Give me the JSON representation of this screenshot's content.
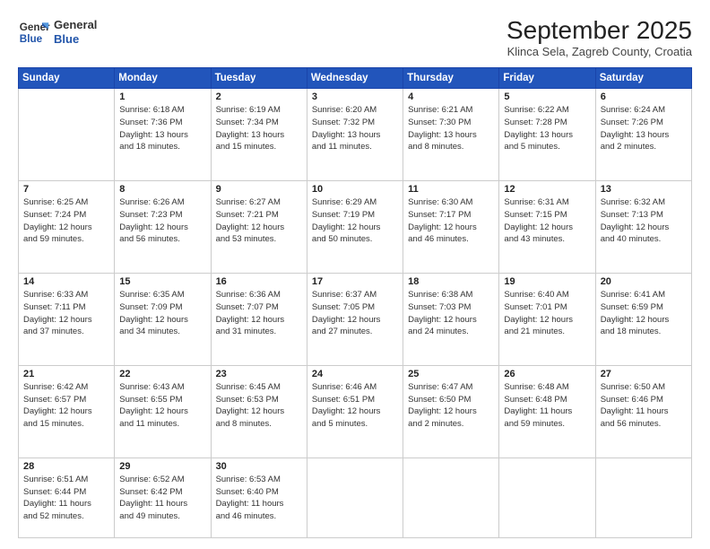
{
  "header": {
    "logo_line1": "General",
    "logo_line2": "Blue",
    "month": "September 2025",
    "location": "Klinca Sela, Zagreb County, Croatia"
  },
  "weekdays": [
    "Sunday",
    "Monday",
    "Tuesday",
    "Wednesday",
    "Thursday",
    "Friday",
    "Saturday"
  ],
  "rows": [
    [
      {
        "day": "",
        "info": ""
      },
      {
        "day": "1",
        "info": "Sunrise: 6:18 AM\nSunset: 7:36 PM\nDaylight: 13 hours\nand 18 minutes."
      },
      {
        "day": "2",
        "info": "Sunrise: 6:19 AM\nSunset: 7:34 PM\nDaylight: 13 hours\nand 15 minutes."
      },
      {
        "day": "3",
        "info": "Sunrise: 6:20 AM\nSunset: 7:32 PM\nDaylight: 13 hours\nand 11 minutes."
      },
      {
        "day": "4",
        "info": "Sunrise: 6:21 AM\nSunset: 7:30 PM\nDaylight: 13 hours\nand 8 minutes."
      },
      {
        "day": "5",
        "info": "Sunrise: 6:22 AM\nSunset: 7:28 PM\nDaylight: 13 hours\nand 5 minutes."
      },
      {
        "day": "6",
        "info": "Sunrise: 6:24 AM\nSunset: 7:26 PM\nDaylight: 13 hours\nand 2 minutes."
      }
    ],
    [
      {
        "day": "7",
        "info": "Sunrise: 6:25 AM\nSunset: 7:24 PM\nDaylight: 12 hours\nand 59 minutes."
      },
      {
        "day": "8",
        "info": "Sunrise: 6:26 AM\nSunset: 7:23 PM\nDaylight: 12 hours\nand 56 minutes."
      },
      {
        "day": "9",
        "info": "Sunrise: 6:27 AM\nSunset: 7:21 PM\nDaylight: 12 hours\nand 53 minutes."
      },
      {
        "day": "10",
        "info": "Sunrise: 6:29 AM\nSunset: 7:19 PM\nDaylight: 12 hours\nand 50 minutes."
      },
      {
        "day": "11",
        "info": "Sunrise: 6:30 AM\nSunset: 7:17 PM\nDaylight: 12 hours\nand 46 minutes."
      },
      {
        "day": "12",
        "info": "Sunrise: 6:31 AM\nSunset: 7:15 PM\nDaylight: 12 hours\nand 43 minutes."
      },
      {
        "day": "13",
        "info": "Sunrise: 6:32 AM\nSunset: 7:13 PM\nDaylight: 12 hours\nand 40 minutes."
      }
    ],
    [
      {
        "day": "14",
        "info": "Sunrise: 6:33 AM\nSunset: 7:11 PM\nDaylight: 12 hours\nand 37 minutes."
      },
      {
        "day": "15",
        "info": "Sunrise: 6:35 AM\nSunset: 7:09 PM\nDaylight: 12 hours\nand 34 minutes."
      },
      {
        "day": "16",
        "info": "Sunrise: 6:36 AM\nSunset: 7:07 PM\nDaylight: 12 hours\nand 31 minutes."
      },
      {
        "day": "17",
        "info": "Sunrise: 6:37 AM\nSunset: 7:05 PM\nDaylight: 12 hours\nand 27 minutes."
      },
      {
        "day": "18",
        "info": "Sunrise: 6:38 AM\nSunset: 7:03 PM\nDaylight: 12 hours\nand 24 minutes."
      },
      {
        "day": "19",
        "info": "Sunrise: 6:40 AM\nSunset: 7:01 PM\nDaylight: 12 hours\nand 21 minutes."
      },
      {
        "day": "20",
        "info": "Sunrise: 6:41 AM\nSunset: 6:59 PM\nDaylight: 12 hours\nand 18 minutes."
      }
    ],
    [
      {
        "day": "21",
        "info": "Sunrise: 6:42 AM\nSunset: 6:57 PM\nDaylight: 12 hours\nand 15 minutes."
      },
      {
        "day": "22",
        "info": "Sunrise: 6:43 AM\nSunset: 6:55 PM\nDaylight: 12 hours\nand 11 minutes."
      },
      {
        "day": "23",
        "info": "Sunrise: 6:45 AM\nSunset: 6:53 PM\nDaylight: 12 hours\nand 8 minutes."
      },
      {
        "day": "24",
        "info": "Sunrise: 6:46 AM\nSunset: 6:51 PM\nDaylight: 12 hours\nand 5 minutes."
      },
      {
        "day": "25",
        "info": "Sunrise: 6:47 AM\nSunset: 6:50 PM\nDaylight: 12 hours\nand 2 minutes."
      },
      {
        "day": "26",
        "info": "Sunrise: 6:48 AM\nSunset: 6:48 PM\nDaylight: 11 hours\nand 59 minutes."
      },
      {
        "day": "27",
        "info": "Sunrise: 6:50 AM\nSunset: 6:46 PM\nDaylight: 11 hours\nand 56 minutes."
      }
    ],
    [
      {
        "day": "28",
        "info": "Sunrise: 6:51 AM\nSunset: 6:44 PM\nDaylight: 11 hours\nand 52 minutes."
      },
      {
        "day": "29",
        "info": "Sunrise: 6:52 AM\nSunset: 6:42 PM\nDaylight: 11 hours\nand 49 minutes."
      },
      {
        "day": "30",
        "info": "Sunrise: 6:53 AM\nSunset: 6:40 PM\nDaylight: 11 hours\nand 46 minutes."
      },
      {
        "day": "",
        "info": ""
      },
      {
        "day": "",
        "info": ""
      },
      {
        "day": "",
        "info": ""
      },
      {
        "day": "",
        "info": ""
      }
    ]
  ]
}
